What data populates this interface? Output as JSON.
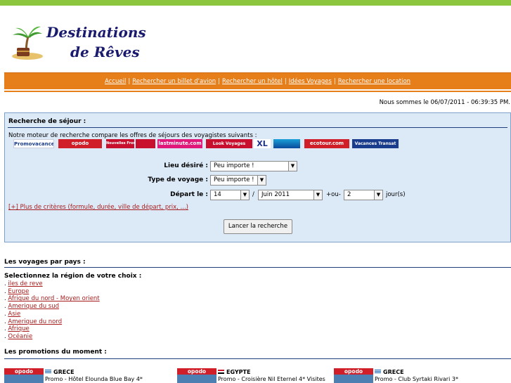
{
  "brand": {
    "line1": "Destinations",
    "line2": "de Rêves"
  },
  "nav": {
    "items": [
      "Accueil",
      "Rechercher un billet d'avion",
      "Rechercher un hôtel",
      "Idées Voyages",
      "Rechercher une location"
    ],
    "separator": "|"
  },
  "date_line": "Nous sommes le 06/07/2011 - 06:39:35 PM.",
  "search": {
    "title": "Recherche de séjour :",
    "engine_text": "Notre moteur de recherche compare les offres de séjours des voyagistes suivants :",
    "operators": [
      "Promovacances",
      "opodo",
      "Nouvelles Frontières",
      "lastminute.com",
      "Look Voyages",
      "XL",
      "",
      "ecotour.com",
      "Vacances Transat"
    ],
    "destination_label": "Lieu désiré :",
    "destination_value": "Peu importe !",
    "type_label": "Type de voyage :",
    "type_value": "Peu importe !",
    "depart_label": "Départ le :",
    "day_value": "14",
    "slash": "/",
    "month_value": "Juin 2011",
    "plusminus_text": "+ou-",
    "days_value": "2",
    "days_suffix": "jour(s)",
    "more_criteria": "[+] Plus de critères (formule, durée, ville de départ, prix, ...)",
    "submit": "Lancer la recherche"
  },
  "by_country": {
    "title": "Les voyages par pays :",
    "select_text": "Selectionnez la région de votre choix :",
    "bullet": ".",
    "regions": [
      "iles de reve",
      "Europe",
      "Afrique du nord - Moyen orient",
      "Amerique du sud",
      "Asie",
      "Amerique du nord",
      "Afrique",
      "Océanie"
    ]
  },
  "promotions": {
    "title": "Les promotions du moment :",
    "operator": "opodo",
    "items": [
      {
        "country": "GRECE",
        "description": "Promo - Hôtel Elounda Blue Bay 4*"
      },
      {
        "country": "EGYPTE",
        "description": "Promo - Croisière Nil Eternel 4* Visites"
      },
      {
        "country": "GRECE",
        "description": "Promo - Club Syrtaki Rivari 3*"
      }
    ]
  },
  "colors": {
    "top_bar": "#8cc63f",
    "nav": "#e67e1a",
    "search_bg": "#dce9f7",
    "rule": "#1f3f7a",
    "link": "#a61c1c"
  }
}
